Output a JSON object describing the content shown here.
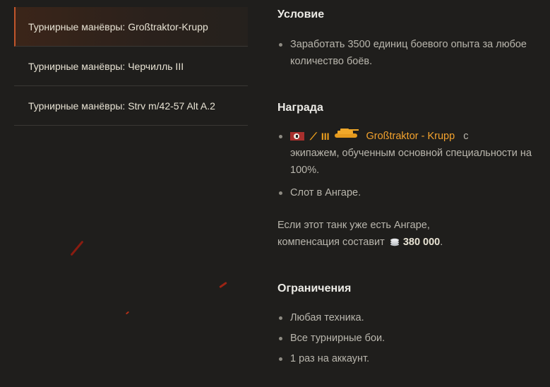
{
  "sidebar": {
    "missions": [
      {
        "label": "Турнирные манёвры: Großtraktor-Krupp",
        "active": true
      },
      {
        "label": "Турнирные манёвры: Черчилль III",
        "active": false
      },
      {
        "label": "Турнирные манёвры: Strv m/42-57 Alt A.2",
        "active": false
      }
    ]
  },
  "details": {
    "condition": {
      "title": "Условие",
      "items": [
        "Заработать 3500 единиц боевого опыта за любое количество боёв."
      ]
    },
    "reward": {
      "title": "Награда",
      "tier": "III",
      "vehicle_name": "Großtraktor - Krupp",
      "vehicle_suffix": "с",
      "vehicle_rest": "экипажем, обученным основной специальности на 100%.",
      "slot": "Слот в Ангаре.",
      "comp_text_1": "Если этот танк уже есть Ангаре,",
      "comp_text_2": "компенсация составит",
      "comp_amount": "380 000",
      "comp_end": "."
    },
    "limits": {
      "title": "Ограничения",
      "items": [
        "Любая техника.",
        "Все турнирные бои.",
        "1 раз на аккаунт."
      ]
    }
  },
  "icons": {
    "flag": "germany-flag-icon",
    "class": "light-tank-class-icon",
    "tank": "tank-icon",
    "credits": "credits-icon"
  },
  "colors": {
    "background": "#1f1e1c",
    "accent": "#f3a22d",
    "active_border": "#c2562b"
  }
}
